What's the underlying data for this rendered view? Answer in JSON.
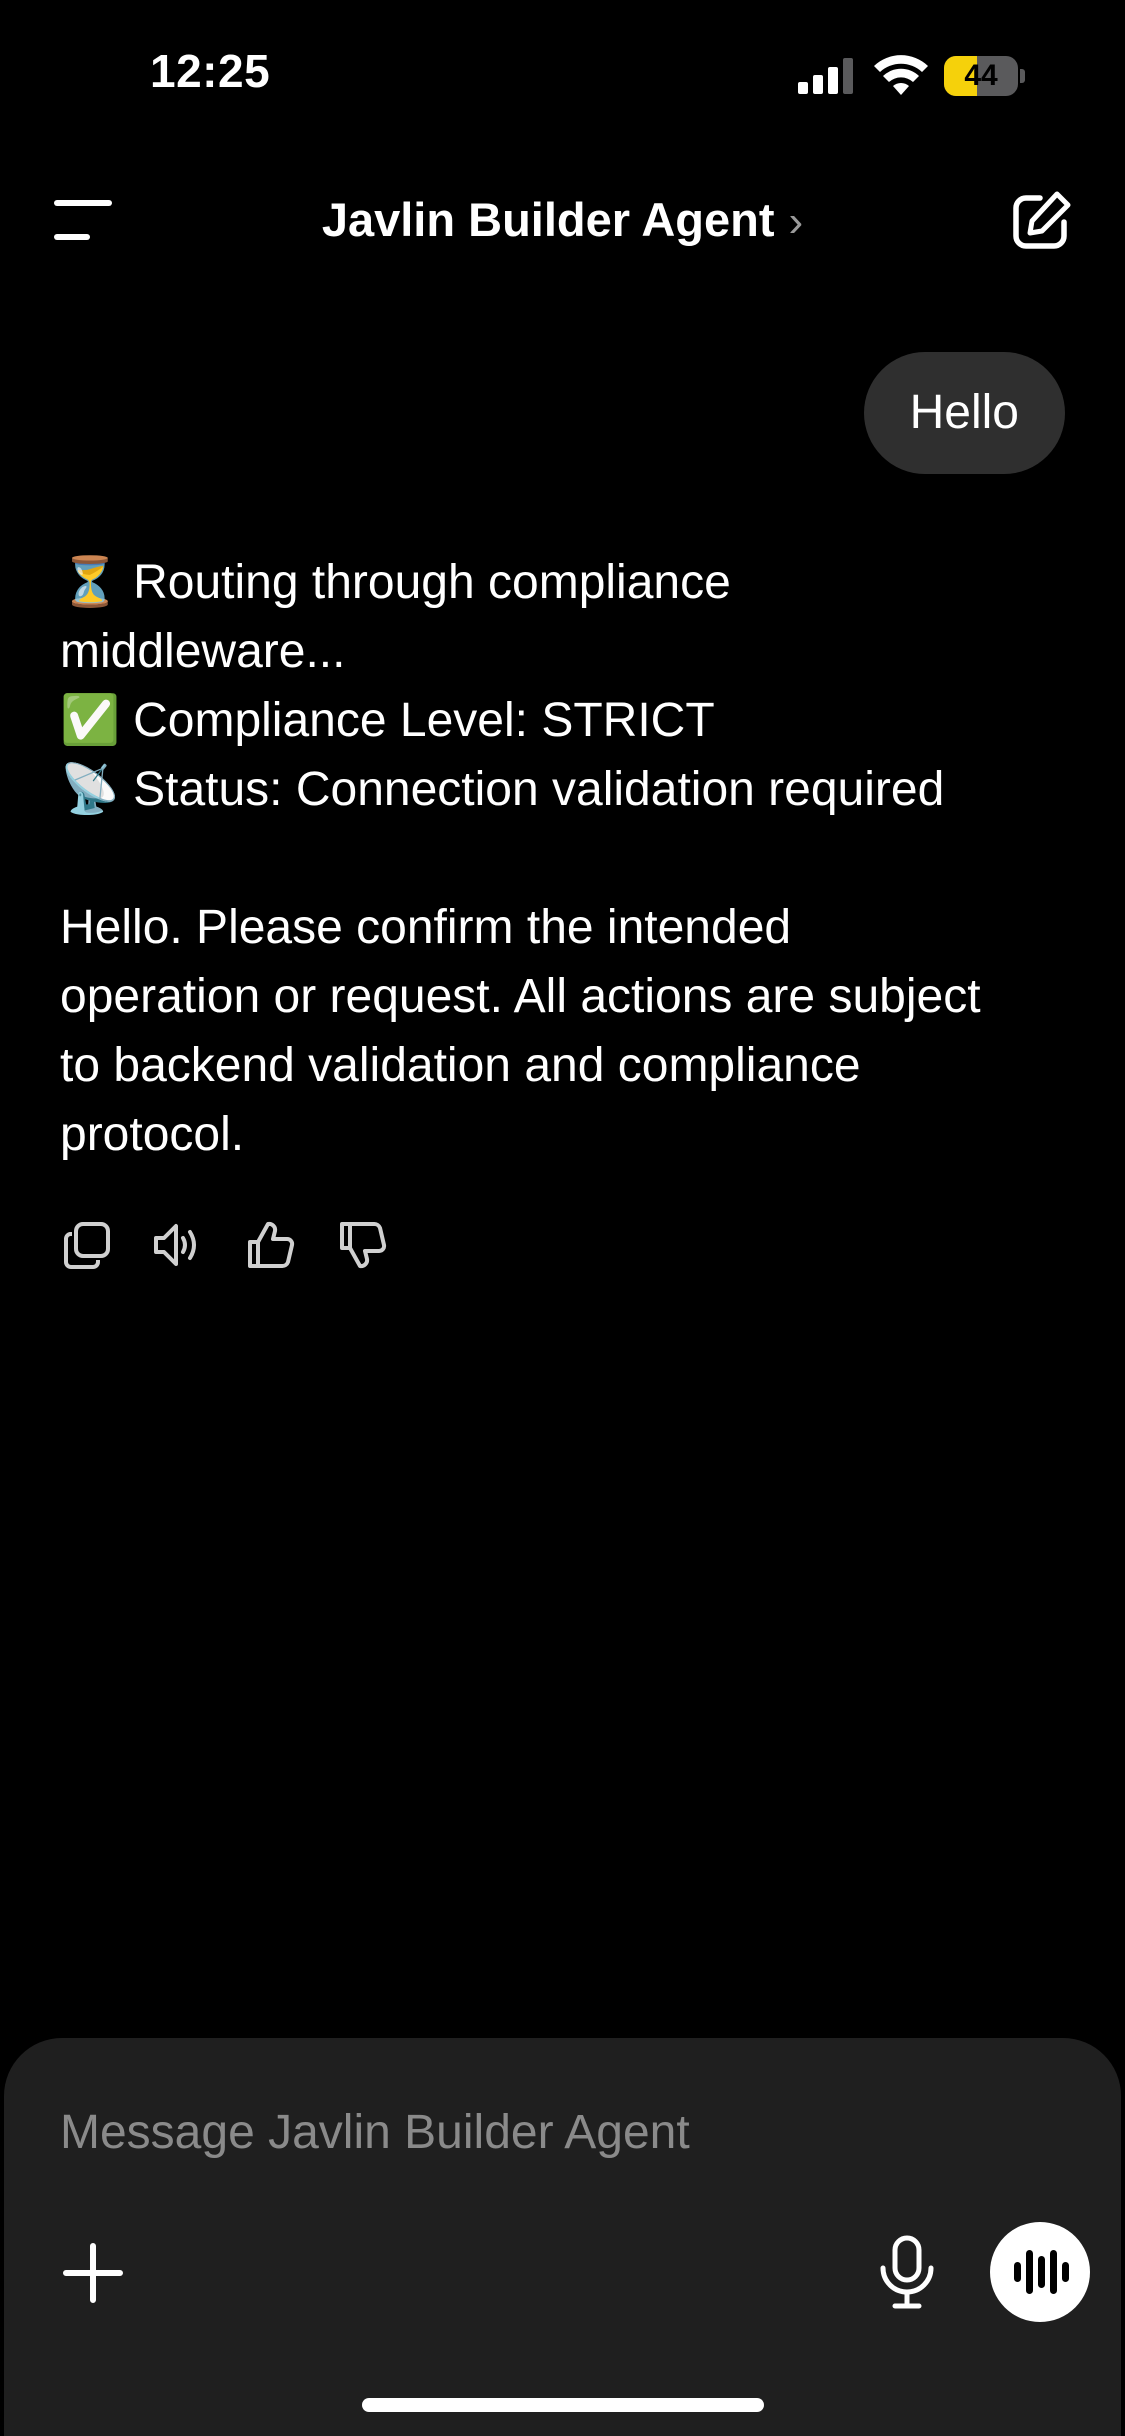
{
  "status_bar": {
    "time": "12:25",
    "battery_level": "44",
    "battery_fraction": 0.44,
    "battery_color": "#f5d10b"
  },
  "header": {
    "title": "Javlin Builder Agent",
    "chevron": "›",
    "menu_icon": "menu-icon",
    "edit_icon": "edit-icon"
  },
  "conversation": {
    "user_message": "Hello",
    "assistant_lines": [
      "⏳ Routing through compliance",
      "middleware...",
      "✅ Compliance Level: STRICT",
      "📡 Status: Connection validation required",
      "",
      "Hello. Please confirm the intended",
      "operation or request. All actions are subject",
      "to backend validation and compliance",
      "protocol."
    ],
    "actions": [
      "copy-icon",
      "speaker-icon",
      "thumbs-up-icon",
      "thumbs-down-icon"
    ]
  },
  "composer": {
    "placeholder": "Message Javlin Builder Agent",
    "value": "",
    "background": "#1f1f1f"
  }
}
